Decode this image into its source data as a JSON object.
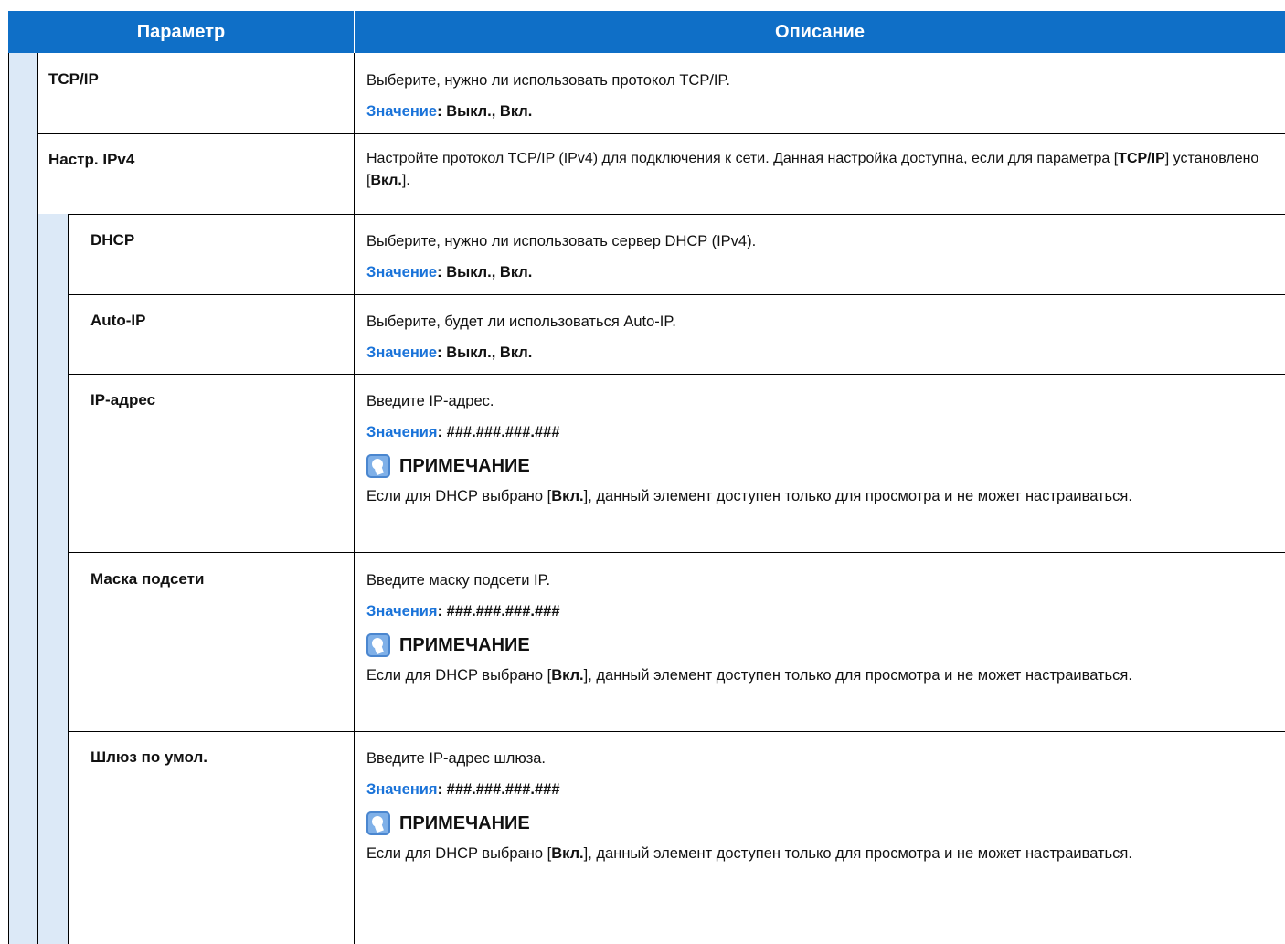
{
  "header": {
    "col_param": "Параметр",
    "col_desc": "Описание"
  },
  "rows": [
    {
      "param": "TCP/IP",
      "desc": "Выберите, нужно ли использовать протокол TCP/IP.",
      "value_key": "Значение",
      "value": ": Выкл., Вкл."
    },
    {
      "param": "Настр. IPv4",
      "desc_a": "Настройте протокол TCP/IP (IPv4) для подключения к сети. Данная настройка доступна, если для параметра [",
      "desc_b": "TCP/IP",
      "desc_c": "] установлено [",
      "desc_d": "Вкл.",
      "desc_e": "]."
    },
    {
      "param": "DHCP",
      "desc": "Выберите, нужно ли использовать сервер DHCP (IPv4).",
      "value_key": "Значение",
      "value": ": Выкл., Вкл."
    },
    {
      "param": "Auto-IP",
      "desc": "Выберите, будет ли использоваться Auto-IP.",
      "value_key": "Значение",
      "value": ": Выкл., Вкл."
    },
    {
      "param": "IP-адрес",
      "desc": "Введите IP-адрес.",
      "value_key": "Значения",
      "value": ": ###.###.###.###"
    },
    {
      "param": "Маска подсети",
      "desc": "Введите маску подсети IP.",
      "value_key": "Значения",
      "value": ": ###.###.###.###"
    },
    {
      "param": "Шлюз по умол.",
      "desc": "Введите IP-адрес шлюза.",
      "value_key": "Значения",
      "value": ": ###.###.###.###"
    }
  ],
  "note": {
    "title": "ПРИМЕЧАНИЕ",
    "text_a": "Если для DHCP выбрано [",
    "text_b": "Вкл.",
    "text_c": "], данный элемент доступен только для просмотра и не может настраиваться.",
    "icon": "note-bulb-icon"
  },
  "colors": {
    "header": "#0f6fc7",
    "value_key": "#1a73d9",
    "indent": "#dce9f7"
  }
}
